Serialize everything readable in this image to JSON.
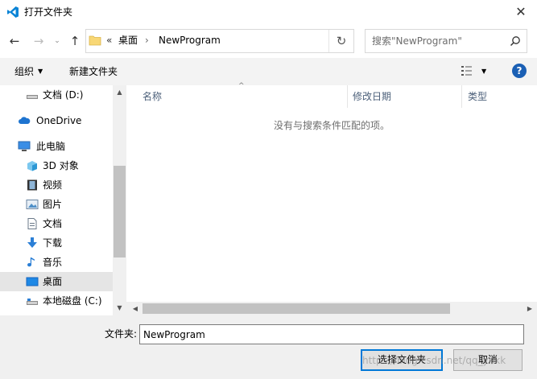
{
  "window": {
    "title": "打开文件夹",
    "close_glyph": "✕"
  },
  "nav": {
    "back": "←",
    "forward": "→",
    "recent": "⌄",
    "up": "↑"
  },
  "address": {
    "overflow": "«",
    "segments": [
      "桌面",
      "NewProgram"
    ],
    "separator": "›",
    "refresh": "↻"
  },
  "search": {
    "placeholder": "搜索\"NewProgram\""
  },
  "toolbar": {
    "organize": "组织",
    "dropdown_glyph": "▼",
    "new_folder": "新建文件夹",
    "help": "?"
  },
  "sidebar": {
    "items": [
      {
        "label": "文档 (D:)",
        "icon": "drive-icon"
      },
      {
        "label": "OneDrive",
        "icon": "cloud-icon"
      },
      {
        "label": "此电脑",
        "icon": "computer-icon"
      },
      {
        "label": "3D 对象",
        "icon": "cube-icon"
      },
      {
        "label": "视频",
        "icon": "video-icon"
      },
      {
        "label": "图片",
        "icon": "picture-icon"
      },
      {
        "label": "文档",
        "icon": "document-icon"
      },
      {
        "label": "下载",
        "icon": "download-icon"
      },
      {
        "label": "音乐",
        "icon": "music-icon"
      },
      {
        "label": "桌面",
        "icon": "desktop-icon",
        "selected": true
      },
      {
        "label": "本地磁盘 (C:)",
        "icon": "local-disk-icon"
      }
    ],
    "scroll_up": "▲",
    "scroll_down": "▼"
  },
  "filelist": {
    "columns": [
      "名称",
      "修改日期",
      "类型"
    ],
    "sort_glyph": "^",
    "empty_message": "没有与搜索条件匹配的项。",
    "scroll_left": "◀",
    "scroll_right": "▶"
  },
  "footer": {
    "folder_label": "文件夹:",
    "folder_value": "NewProgram",
    "select_button": "选择文件夹",
    "cancel_button": "取消"
  },
  "watermark": "https://blog.csdn.net/qq_yhkk",
  "colors": {
    "accent": "#0078d7",
    "vscode_blue": "#0a84d6",
    "selection": "#e5e5e5",
    "help_blue": "#1a5fb4"
  }
}
